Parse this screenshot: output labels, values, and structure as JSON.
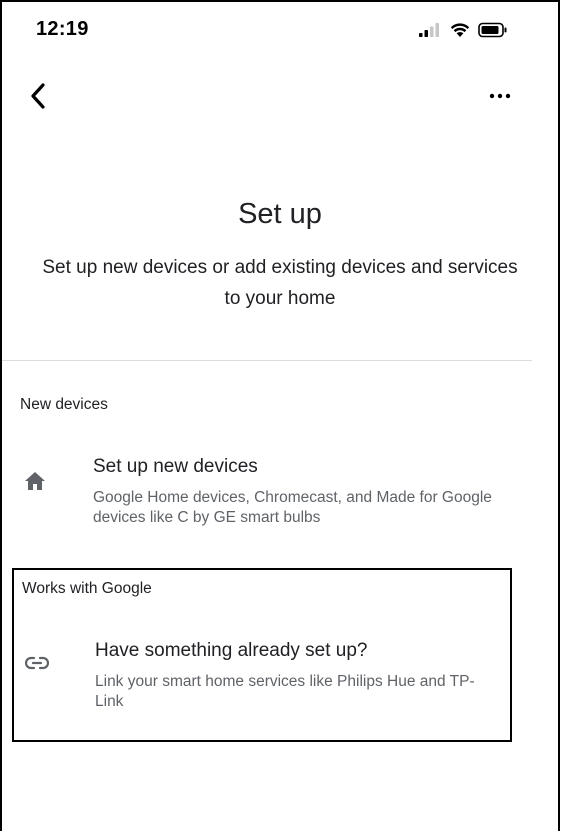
{
  "status_bar": {
    "time": "12:19",
    "icons": [
      "signal-icon",
      "wifi-icon",
      "battery-icon"
    ]
  },
  "app_bar": {
    "back_icon": "chevron-left-icon",
    "more_icon": "more-horizontal-icon"
  },
  "header": {
    "title": "Set up",
    "subtitle": "Set up new devices or add existing devices and services to your home"
  },
  "sections": {
    "new_devices": {
      "label": "New devices",
      "item": {
        "icon": "home-icon",
        "title": "Set up new devices",
        "description": "Google Home devices, Chromecast, and Made for Google devices like C by GE smart bulbs"
      }
    },
    "works_with_google": {
      "label": "Works with Google",
      "item": {
        "icon": "link-icon",
        "title": "Have something already set up?",
        "description": "Link your smart home services like Philips Hue and TP-Link"
      }
    }
  },
  "colors": {
    "text_primary": "#202124",
    "text_secondary": "#5f6368",
    "icon": "#5f6368",
    "divider": "#dadce0",
    "highlight_border": "#000000"
  }
}
